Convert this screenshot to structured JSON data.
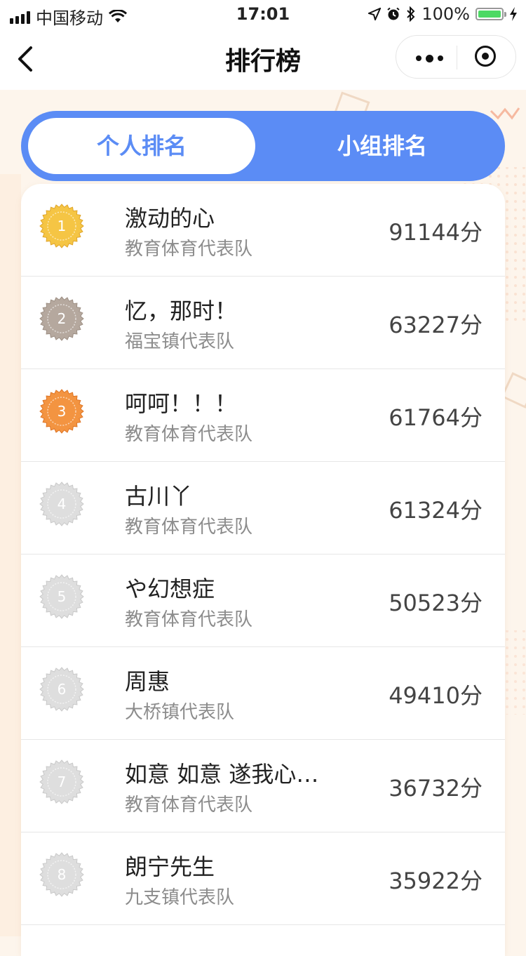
{
  "status_bar": {
    "carrier": "中国移动",
    "time": "17:01",
    "battery_percent": "100%"
  },
  "nav": {
    "title": "排行榜",
    "icons": [
      "back-chevron-icon",
      "more-dots-icon",
      "record-target-icon"
    ]
  },
  "tabs": [
    {
      "label": "个人排名",
      "active": true
    },
    {
      "label": "小组排名",
      "active": false
    }
  ],
  "colors": {
    "accent": "#5b8cf5",
    "gold": "#f2c03d",
    "silver": "#b3a69d",
    "bronze": "#f08a36",
    "gray_medal": "#d9d9d9"
  },
  "ranking": [
    {
      "rank": "1",
      "name": "激动的心",
      "team": "教育体育代表队",
      "score": "91144分",
      "medal": "gold"
    },
    {
      "rank": "2",
      "name": "忆，那时！",
      "team": "福宝镇代表队",
      "score": "63227分",
      "medal": "silver"
    },
    {
      "rank": "3",
      "name": "呵呵！！！",
      "team": "教育体育代表队",
      "score": "61764分",
      "medal": "bronze"
    },
    {
      "rank": "4",
      "name": "古川丫",
      "team": "教育体育代表队",
      "score": "61324分",
      "medal": "gray"
    },
    {
      "rank": "5",
      "name": "や幻想症",
      "team": "教育体育代表队",
      "score": "50523分",
      "medal": "gray"
    },
    {
      "rank": "6",
      "name": "周惠",
      "team": "大桥镇代表队",
      "score": "49410分",
      "medal": "gray"
    },
    {
      "rank": "7",
      "name": "如意 如意 遂我心…",
      "team": "教育体育代表队",
      "score": "36732分",
      "medal": "gray"
    },
    {
      "rank": "8",
      "name": "朗宁先生",
      "team": "九支镇代表队",
      "score": "35922分",
      "medal": "gray"
    }
  ]
}
